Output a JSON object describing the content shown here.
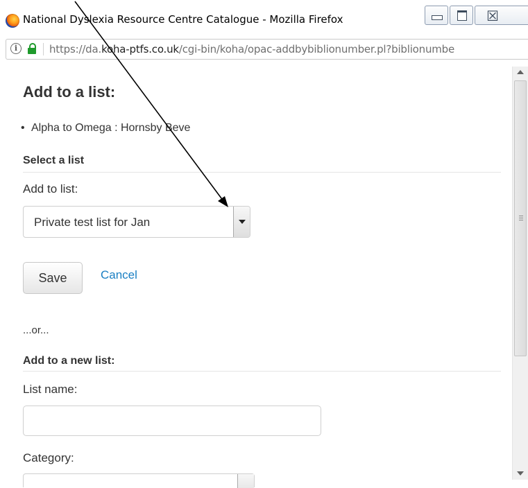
{
  "window": {
    "title": "National Dyslexia Resource Centre Catalogue - Mozilla Firefox",
    "close_glyph": "☒"
  },
  "urlbar": {
    "prefix": "https://da.",
    "domain": "koha-ptfs.co.uk",
    "path": "/cgi-bin/koha/opac-addbybiblionumber.pl?biblionumbe",
    "info_glyph": "i"
  },
  "page": {
    "heading": "Add to a list:",
    "items": [
      "Alpha to Omega : Hornsby Beve"
    ],
    "select_section": "Select a list",
    "add_to_list_label": "Add to list:",
    "selected_list": "Private test list for Jan",
    "save_label": "Save",
    "cancel_label": "Cancel",
    "or_text": "...or...",
    "new_list_section": "Add to a new list:",
    "list_name_label": "List name:",
    "list_name_value": "",
    "category_label": "Category:"
  },
  "icons": {
    "app": "firefox-icon",
    "info": "info-icon",
    "lock": "lock-icon",
    "dropdown": "dropdown-arrow-icon",
    "annotation": "annotation-arrow"
  },
  "colors": {
    "link": "#1a7fc3",
    "lock": "#1f9a2c",
    "text": "#333333"
  }
}
